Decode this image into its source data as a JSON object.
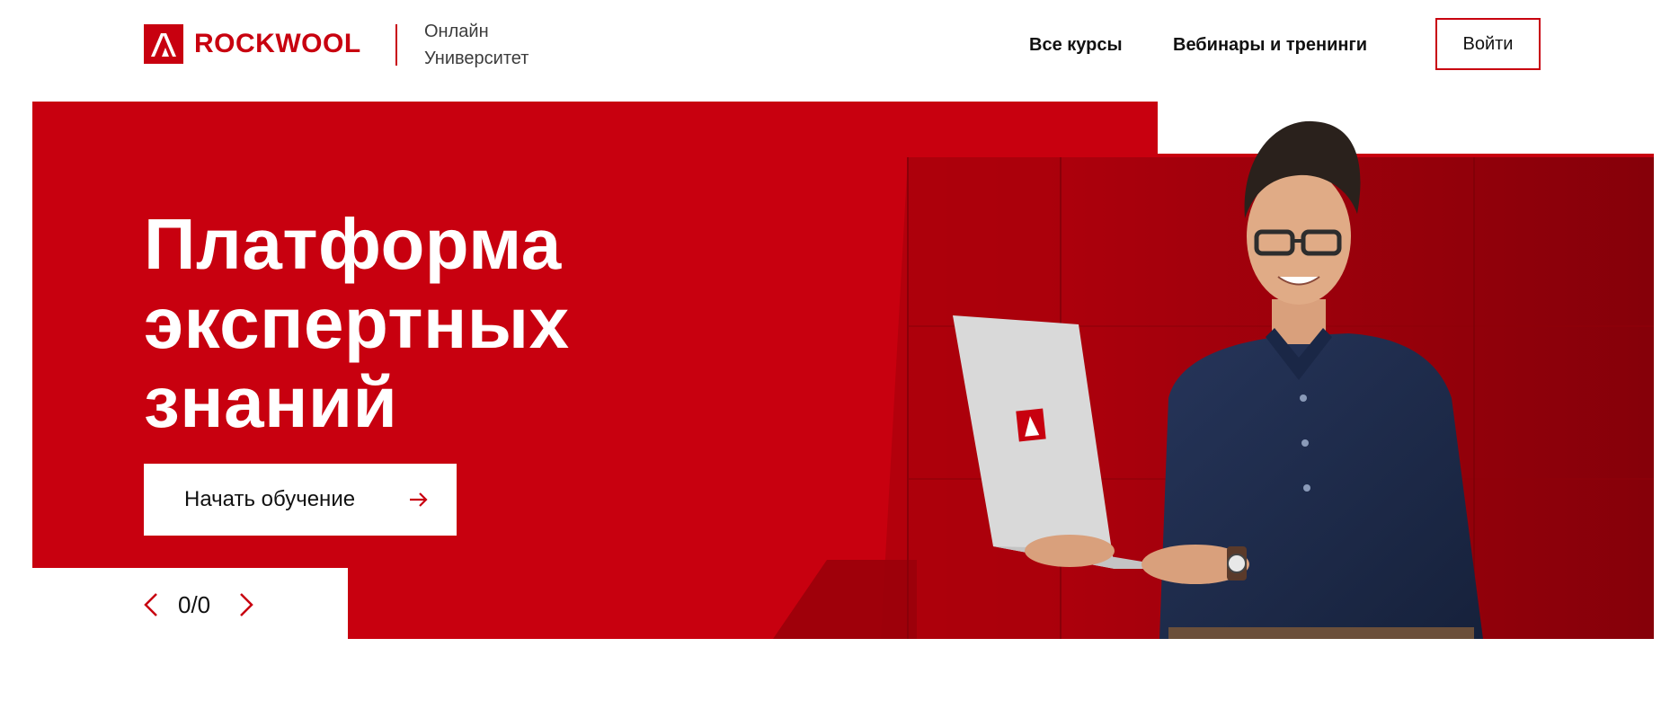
{
  "header": {
    "brand": "ROCKWOOL",
    "subtitle_line1": "Онлайн",
    "subtitle_line2": "Университет",
    "nav": {
      "courses": "Все курсы",
      "webinars": "Вебинары и тренинги"
    },
    "login_label": "Войти"
  },
  "hero": {
    "title_line1": "Платформа",
    "title_line2": "экспертных",
    "title_line3": "знаний",
    "cta_label": "Начать обучение",
    "slider_counter": "0/0"
  },
  "colors": {
    "brand_red": "#c8000f",
    "dark_red": "#8e0009",
    "shirt_navy": "#1e2b4a"
  },
  "icons": {
    "prev": "chevron-left-icon",
    "next": "chevron-right-icon",
    "cta": "arrow-right-icon",
    "logo": "rockwool-logo-icon"
  }
}
